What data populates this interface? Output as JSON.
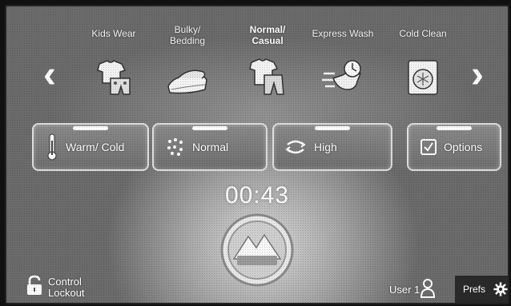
{
  "cycles": [
    {
      "label": "Kids Wear",
      "icon": "kids-wear-icon"
    },
    {
      "label": "Bulky/ Bedding",
      "icon": "bulky-bedding-icon"
    },
    {
      "label": "Normal/ Casual",
      "icon": "normal-casual-icon",
      "selected": true
    },
    {
      "label": "Express Wash",
      "icon": "express-wash-icon"
    },
    {
      "label": "Cold Clean",
      "icon": "cold-clean-icon"
    }
  ],
  "settings": {
    "temperature": {
      "label": "Warm/ Cold",
      "icon": "thermometer-icon"
    },
    "soil": {
      "label": "Normal",
      "icon": "soil-level-icon"
    },
    "spin": {
      "label": "High",
      "icon": "spin-speed-icon"
    },
    "options": {
      "label": "Options",
      "icon": "checkbox-icon"
    }
  },
  "timer": "00:43",
  "bottom": {
    "control_lockout": "Control Lockout",
    "user": "User 1",
    "prefs": "Prefs"
  },
  "colors": {
    "background": "#6b6b6b",
    "pill": "#7d7d7d",
    "prefs_bar": "#2a2a2a"
  }
}
